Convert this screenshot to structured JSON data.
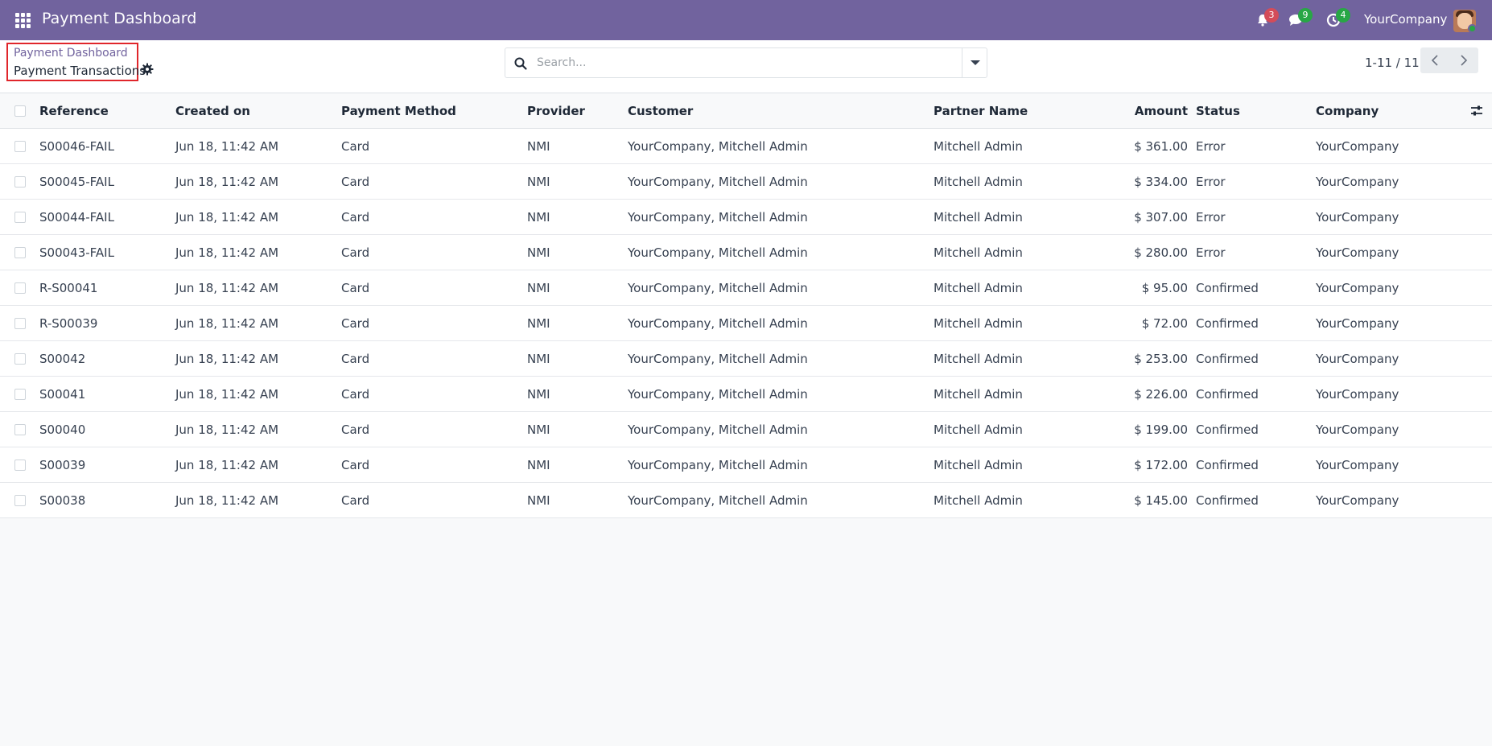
{
  "navbar": {
    "brand": "Payment Dashboard",
    "activity_count": "3",
    "messages_count": "9",
    "activities_count": "4",
    "company": "YourCompany"
  },
  "breadcrumb": {
    "parent": "Payment Dashboard",
    "current": "Payment Transactions"
  },
  "search": {
    "placeholder": "Search..."
  },
  "pager": {
    "text": "1-11 / 11"
  },
  "table": {
    "headers": {
      "reference": "Reference",
      "created": "Created on",
      "method": "Payment Method",
      "provider": "Provider",
      "customer": "Customer",
      "partner": "Partner Name",
      "amount": "Amount",
      "status": "Status",
      "company": "Company"
    },
    "rows": [
      {
        "reference": "S00046-FAIL",
        "created": "Jun 18, 11:42 AM",
        "method": "Card",
        "provider": "NMI",
        "customer": "YourCompany, Mitchell Admin",
        "partner": "Mitchell Admin",
        "amount": "$ 361.00",
        "status": "Error",
        "company": "YourCompany"
      },
      {
        "reference": "S00045-FAIL",
        "created": "Jun 18, 11:42 AM",
        "method": "Card",
        "provider": "NMI",
        "customer": "YourCompany, Mitchell Admin",
        "partner": "Mitchell Admin",
        "amount": "$ 334.00",
        "status": "Error",
        "company": "YourCompany"
      },
      {
        "reference": "S00044-FAIL",
        "created": "Jun 18, 11:42 AM",
        "method": "Card",
        "provider": "NMI",
        "customer": "YourCompany, Mitchell Admin",
        "partner": "Mitchell Admin",
        "amount": "$ 307.00",
        "status": "Error",
        "company": "YourCompany"
      },
      {
        "reference": "S00043-FAIL",
        "created": "Jun 18, 11:42 AM",
        "method": "Card",
        "provider": "NMI",
        "customer": "YourCompany, Mitchell Admin",
        "partner": "Mitchell Admin",
        "amount": "$ 280.00",
        "status": "Error",
        "company": "YourCompany"
      },
      {
        "reference": "R-S00041",
        "created": "Jun 18, 11:42 AM",
        "method": "Card",
        "provider": "NMI",
        "customer": "YourCompany, Mitchell Admin",
        "partner": "Mitchell Admin",
        "amount": "$ 95.00",
        "status": "Confirmed",
        "company": "YourCompany"
      },
      {
        "reference": "R-S00039",
        "created": "Jun 18, 11:42 AM",
        "method": "Card",
        "provider": "NMI",
        "customer": "YourCompany, Mitchell Admin",
        "partner": "Mitchell Admin",
        "amount": "$ 72.00",
        "status": "Confirmed",
        "company": "YourCompany"
      },
      {
        "reference": "S00042",
        "created": "Jun 18, 11:42 AM",
        "method": "Card",
        "provider": "NMI",
        "customer": "YourCompany, Mitchell Admin",
        "partner": "Mitchell Admin",
        "amount": "$ 253.00",
        "status": "Confirmed",
        "company": "YourCompany"
      },
      {
        "reference": "S00041",
        "created": "Jun 18, 11:42 AM",
        "method": "Card",
        "provider": "NMI",
        "customer": "YourCompany, Mitchell Admin",
        "partner": "Mitchell Admin",
        "amount": "$ 226.00",
        "status": "Confirmed",
        "company": "YourCompany"
      },
      {
        "reference": "S00040",
        "created": "Jun 18, 11:42 AM",
        "method": "Card",
        "provider": "NMI",
        "customer": "YourCompany, Mitchell Admin",
        "partner": "Mitchell Admin",
        "amount": "$ 199.00",
        "status": "Confirmed",
        "company": "YourCompany"
      },
      {
        "reference": "S00039",
        "created": "Jun 18, 11:42 AM",
        "method": "Card",
        "provider": "NMI",
        "customer": "YourCompany, Mitchell Admin",
        "partner": "Mitchell Admin",
        "amount": "$ 172.00",
        "status": "Confirmed",
        "company": "YourCompany"
      },
      {
        "reference": "S00038",
        "created": "Jun 18, 11:42 AM",
        "method": "Card",
        "provider": "NMI",
        "customer": "YourCompany, Mitchell Admin",
        "partner": "Mitchell Admin",
        "amount": "$ 145.00",
        "status": "Confirmed",
        "company": "YourCompany"
      }
    ]
  },
  "colors": {
    "navbar": "#71639e",
    "badge_red": "#d44c59",
    "badge_green": "#28a745",
    "highlight_border": "#e0262b"
  },
  "icons": {
    "apps": "apps-grid-icon",
    "bell": "bell-icon",
    "chat": "chat-icon",
    "clock": "clock-icon",
    "gear": "gear-icon",
    "search": "search-icon",
    "dropdown": "caret-down-icon",
    "prev": "chevron-left-icon",
    "next": "chevron-right-icon",
    "optional_columns": "sliders-icon"
  }
}
